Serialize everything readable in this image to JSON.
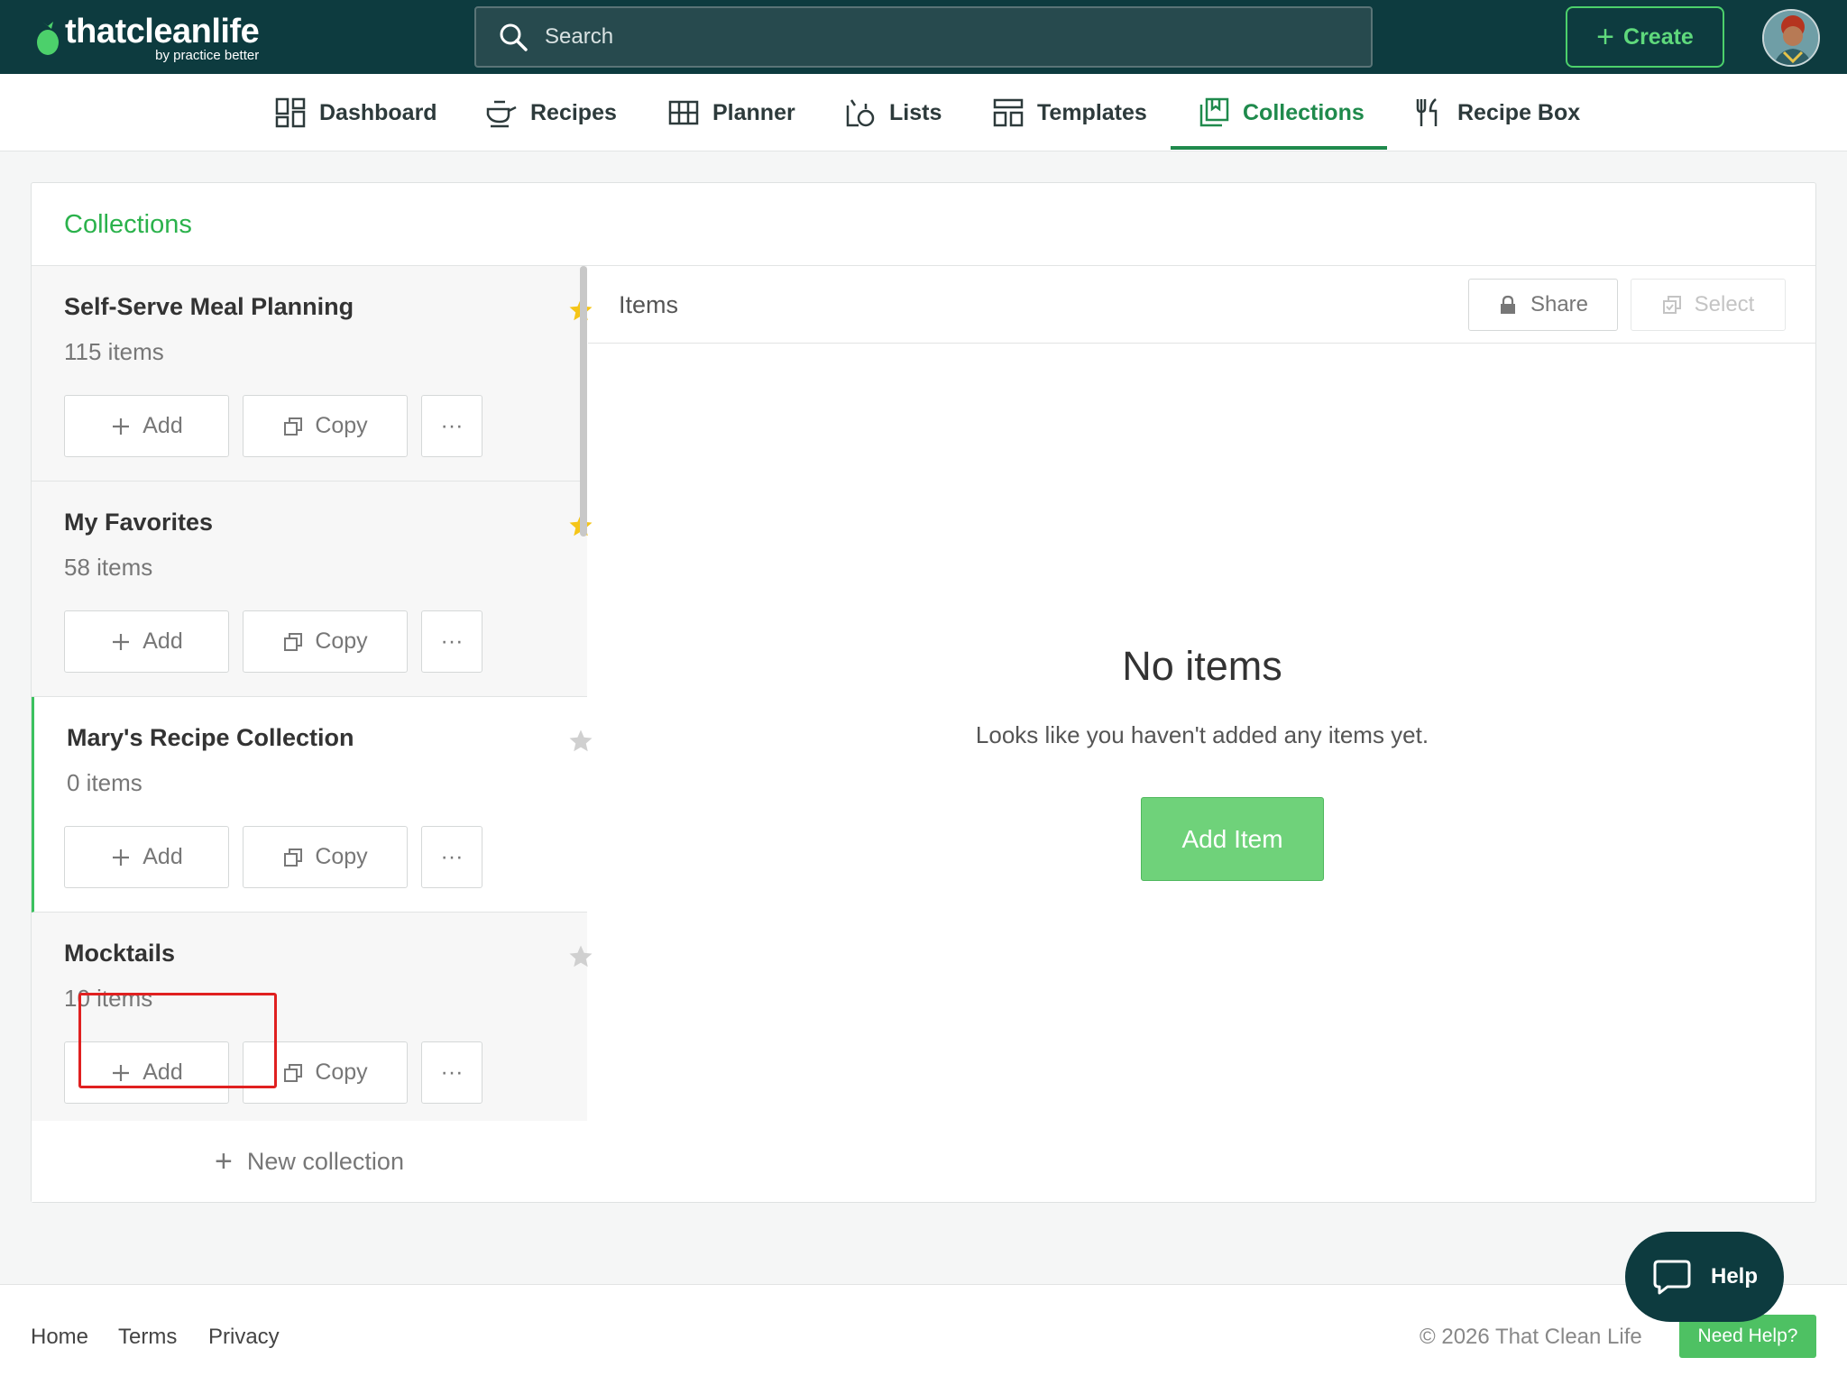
{
  "brand": {
    "name": "thatcleanlife",
    "byline": "by practice better"
  },
  "search": {
    "placeholder": "Search"
  },
  "create_label": "Create",
  "nav": [
    {
      "label": "Dashboard",
      "icon": "dashboard-icon"
    },
    {
      "label": "Recipes",
      "icon": "recipes-icon"
    },
    {
      "label": "Planner",
      "icon": "planner-icon"
    },
    {
      "label": "Lists",
      "icon": "lists-icon"
    },
    {
      "label": "Templates",
      "icon": "templates-icon"
    },
    {
      "label": "Collections",
      "icon": "collections-icon",
      "active": true
    },
    {
      "label": "Recipe Box",
      "icon": "recipe-box-icon"
    }
  ],
  "page_title": "Collections",
  "collections": [
    {
      "name": "Self-Serve Meal Planning",
      "count": "115 items",
      "starred": true
    },
    {
      "name": "My Favorites",
      "count": "58 items",
      "starred": true
    },
    {
      "name": "Mary's Recipe Collection",
      "count": "0 items",
      "starred": false,
      "selected": true
    },
    {
      "name": "Mocktails",
      "count": "10 items",
      "starred": false
    }
  ],
  "collection_actions": {
    "add": "Add",
    "copy": "Copy",
    "more": "···"
  },
  "new_collection_label": "New collection",
  "items_panel": {
    "title": "Items",
    "share_label": "Share",
    "select_label": "Select",
    "empty_title": "No items",
    "empty_message": "Looks like you haven't added any items yet.",
    "add_item_label": "Add Item"
  },
  "footer": {
    "links": [
      "Home",
      "Terms",
      "Privacy"
    ],
    "copyright": "© 2026 That Clean Life",
    "need_help": "Need Help?"
  },
  "help_label": "Help",
  "colors": {
    "topbar": "#0d3b3f",
    "accent_green": "#2bb24c",
    "active_nav": "#1f8a4c",
    "star_on": "#f5c518",
    "star_off": "#d0d0d0",
    "highlight": "#e02020"
  }
}
